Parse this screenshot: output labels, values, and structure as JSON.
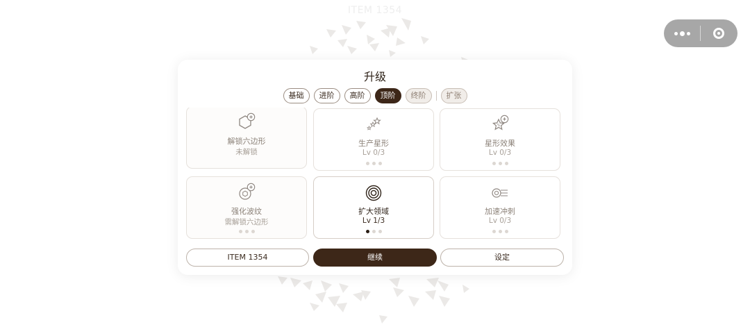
{
  "background": {
    "title": "ITEM 1354"
  },
  "capsule": {
    "more_icon": "more-dots-icon",
    "close_icon": "target-close-icon"
  },
  "panel": {
    "title": "升级",
    "tabs": [
      {
        "label": "基础",
        "state": "normal"
      },
      {
        "label": "进阶",
        "state": "normal"
      },
      {
        "label": "高阶",
        "state": "normal"
      },
      {
        "label": "顶阶",
        "state": "active"
      },
      {
        "label": "终阶",
        "state": "muted"
      },
      {
        "label": "扩张",
        "state": "muted"
      }
    ],
    "cards": [
      {
        "name": "解锁六边形",
        "status": "未解锁",
        "icon": "hexagon-plus-icon",
        "level_filled": null
      },
      {
        "name": "生产星形",
        "status": "Lv 0/3",
        "icon": "stars-trail-icon",
        "level_filled": 0
      },
      {
        "name": "星形效果",
        "status": "Lv 0/3",
        "icon": "star-plus-icon",
        "level_filled": 0
      },
      {
        "name": "强化波纹",
        "status": "需解锁六边形",
        "icon": "ripple-plus-icon",
        "level_filled": 0
      },
      {
        "name": "扩大领域",
        "status": "Lv 1/3",
        "icon": "concentric-rings-icon",
        "level_filled": 1
      },
      {
        "name": "加速冲刺",
        "status": "Lv 0/3",
        "icon": "dash-speed-icon",
        "level_filled": 0
      }
    ],
    "buttons": {
      "left": "ITEM 1354",
      "center": "继续",
      "right": "设定"
    }
  },
  "colors": {
    "accent": "#3d2718",
    "muted_text": "#8c8279",
    "shard": "#ebe9e7"
  }
}
